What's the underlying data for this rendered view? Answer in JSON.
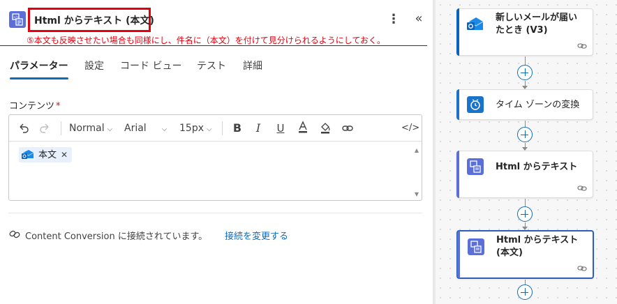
{
  "panel": {
    "title": "Html からテキスト (本文)",
    "annotation": "⑤本文も反映させたい場合も同様にし、件名に（本文）を付けて見分けられるようにしておく。",
    "more_icon": "more-vertical-icon",
    "collapse_icon": "chevron-double-left-icon",
    "tabs": [
      {
        "label": "パラメーター",
        "active": true
      },
      {
        "label": "設定"
      },
      {
        "label": "コード ビュー"
      },
      {
        "label": "テスト"
      },
      {
        "label": "詳細"
      }
    ],
    "field": {
      "label": "コンテンツ",
      "required_mark": "*"
    },
    "toolbar": {
      "paragraph_format": "Normal",
      "font_family": "Arial",
      "font_size": "15px",
      "bold": "B",
      "italic": "I",
      "underline": "U"
    },
    "token": {
      "label": "本文",
      "remove": "✕"
    },
    "connection": {
      "text": "Content Conversion に接続されています。",
      "link": "接続を変更する"
    }
  },
  "canvas": {
    "cards": [
      {
        "title_line1": "新しいメールが届い",
        "title_line2": "たとき (V3)"
      },
      {
        "title_line1": "タイム ゾーンの変換"
      },
      {
        "title_line1": "Html からテキスト"
      },
      {
        "title_line1": "Html からテキスト",
        "title_line2": "(本文)"
      }
    ]
  },
  "colors": {
    "accent": "#0f6cbd",
    "annotation_red": "#e3000f",
    "action_purple": "#5b6fd9",
    "outlook_blue": "#0a62bf",
    "timezone_blue": "#1a73c8"
  }
}
